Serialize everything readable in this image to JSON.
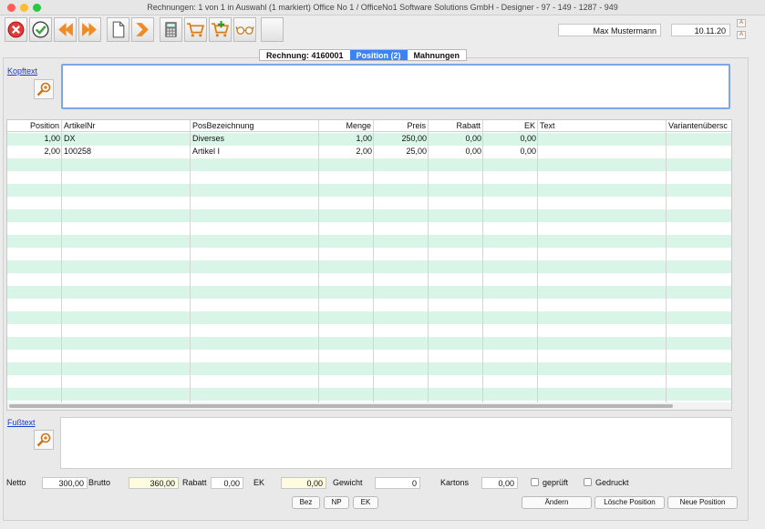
{
  "window": {
    "title": "Rechnungen: 1 von 1 in Auswahl  (1 markiert) Office No 1 /  OfficeNo1 Software Solutions GmbH - Designer - 97 - 149 - 1287 - 949",
    "traffic_colors": [
      "#fe5f57",
      "#febc2e",
      "#28c840"
    ]
  },
  "toolbar": {
    "user": "Max Mustermann",
    "date": "10.11.20",
    "buttons": [
      "cancel-icon",
      "confirm-icon",
      "back-icon",
      "forward-icon",
      "document-icon",
      "next-icon",
      "calculator-icon",
      "cart-icon",
      "cart-add-icon",
      "glasses-icon",
      "blank-icon"
    ],
    "zoom_up": "A",
    "zoom_down": "A"
  },
  "tabs": [
    {
      "label": "Rechnung:  4160001",
      "active": false
    },
    {
      "label": "Position (2)",
      "active": true
    },
    {
      "label": "Mahnungen",
      "active": false
    }
  ],
  "kopftext": {
    "label": "Kopftext",
    "value": ""
  },
  "fusstext": {
    "label": "Fußtext",
    "value": ""
  },
  "table": {
    "columns": [
      "Position",
      "ArtikelNr",
      "PosBezeichnung",
      "Menge",
      "Preis",
      "Rabatt",
      "EK",
      "Text",
      "Variantenübersc"
    ],
    "rows": [
      [
        "1,00",
        "DX",
        "Diverses",
        "1,00",
        "250,00",
        "0,00",
        "0,00",
        "",
        ""
      ],
      [
        "2,00",
        "100258",
        "Artikel I",
        "2,00",
        "25,00",
        "0,00",
        "0,00",
        "",
        ""
      ]
    ],
    "empty_rows": 20,
    "alt_row_color": "#d8f5e8"
  },
  "footer": {
    "netto_label": "Netto",
    "netto": "300,00",
    "brutto_label": "Brutto",
    "brutto": "360,00",
    "rabatt_label": "Rabatt",
    "rabatt": "0,00",
    "ek_label": "EK",
    "ek": "0,00",
    "gewicht_label": "Gewicht",
    "gewicht": "0",
    "kartons_label": "Kartons",
    "kartons": "0,00",
    "geprueft_label": "geprüft",
    "geprueft": false,
    "gedruckt_label": "Gedruckt",
    "gedruckt": false
  },
  "buttons": {
    "bez": "Bez",
    "np": "NP",
    "ek": "EK",
    "aendern": "Ändern",
    "loesche": "Lösche Position",
    "neue": "Neue Position"
  }
}
